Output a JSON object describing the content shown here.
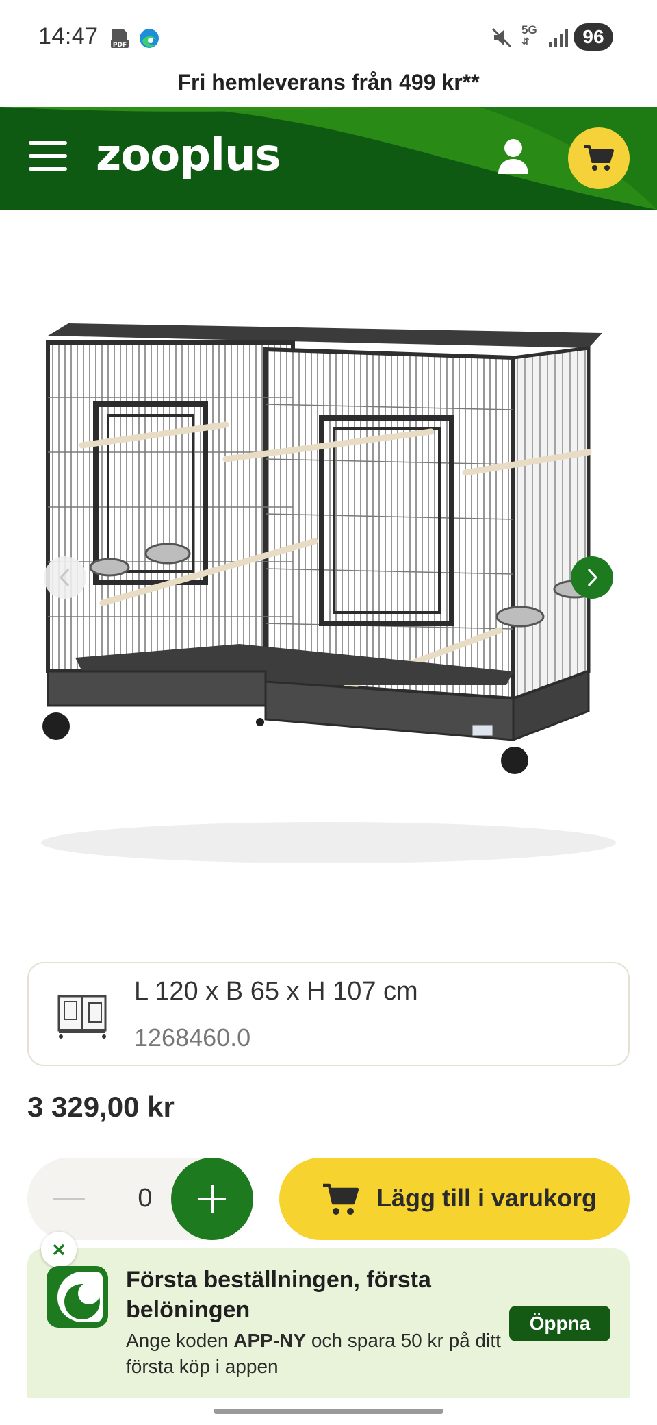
{
  "status_bar": {
    "time": "14:47",
    "network": "5G",
    "battery": "96"
  },
  "promo": {
    "text": "Fri hemleverans från 499 kr**"
  },
  "header": {
    "logo": "zooplus",
    "brand_color": "#0f5a12",
    "cart_color": "#f5d23a"
  },
  "variant": {
    "title": "L 120 x B 65 x H 107 cm",
    "sku": "1268460.0"
  },
  "product": {
    "price": "3 329,00 kr"
  },
  "purchase": {
    "quantity": "0",
    "add_to_cart_label": "Lägg till i varukorg"
  },
  "app_banner": {
    "title": "Första beställningen, första belöningen",
    "body_prefix": "Ange koden ",
    "code": "APP-NY",
    "body_suffix": " och spara 50 kr på ditt första köp i appen",
    "open_label": "Öppna"
  }
}
